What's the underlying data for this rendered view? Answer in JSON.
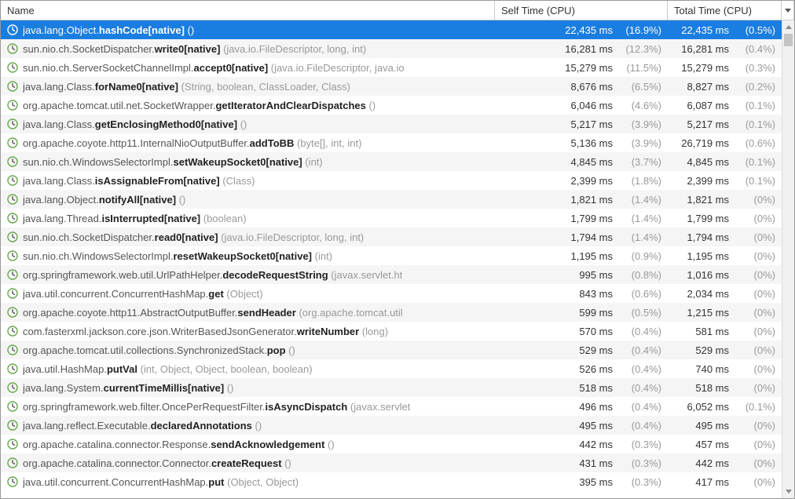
{
  "columns": {
    "name": "Name",
    "self": "Self Time (CPU)",
    "total": "Total Time (CPU)"
  },
  "rows": [
    {
      "selected": true,
      "prefix": "java.lang.Object.",
      "bold": "hashCode[native]",
      "params": " ()",
      "self_ms": "22,435 ms",
      "self_pct": "(16.9%)",
      "total_ms": "22,435 ms",
      "total_pct": "(0.5%)"
    },
    {
      "selected": false,
      "prefix": "sun.nio.ch.SocketDispatcher.",
      "bold": "write0[native]",
      "params": " (java.io.FileDescriptor, long, int)",
      "self_ms": "16,281 ms",
      "self_pct": "(12.3%)",
      "total_ms": "16,281 ms",
      "total_pct": "(0.4%)"
    },
    {
      "selected": false,
      "prefix": "sun.nio.ch.ServerSocketChannelImpl.",
      "bold": "accept0[native]",
      "params": " (java.io.FileDescriptor, java.io",
      "self_ms": "15,279 ms",
      "self_pct": "(11.5%)",
      "total_ms": "15,279 ms",
      "total_pct": "(0.3%)"
    },
    {
      "selected": false,
      "prefix": "java.lang.Class.",
      "bold": "forName0[native]",
      "params": " (String, boolean, ClassLoader, Class)",
      "self_ms": "8,676 ms",
      "self_pct": "(6.5%)",
      "total_ms": "8,827 ms",
      "total_pct": "(0.2%)"
    },
    {
      "selected": false,
      "prefix": "org.apache.tomcat.util.net.SocketWrapper.",
      "bold": "getIteratorAndClearDispatches",
      "params": " ()",
      "self_ms": "6,046 ms",
      "self_pct": "(4.6%)",
      "total_ms": "6,087 ms",
      "total_pct": "(0.1%)"
    },
    {
      "selected": false,
      "prefix": "java.lang.Class.",
      "bold": "getEnclosingMethod0[native]",
      "params": " ()",
      "self_ms": "5,217 ms",
      "self_pct": "(3.9%)",
      "total_ms": "5,217 ms",
      "total_pct": "(0.1%)"
    },
    {
      "selected": false,
      "prefix": "org.apache.coyote.http11.InternalNioOutputBuffer.",
      "bold": "addToBB",
      "params": " (byte[], int, int)",
      "self_ms": "5,136 ms",
      "self_pct": "(3.9%)",
      "total_ms": "26,719 ms",
      "total_pct": "(0.6%)"
    },
    {
      "selected": false,
      "prefix": "sun.nio.ch.WindowsSelectorImpl.",
      "bold": "setWakeupSocket0[native]",
      "params": " (int)",
      "self_ms": "4,845 ms",
      "self_pct": "(3.7%)",
      "total_ms": "4,845 ms",
      "total_pct": "(0.1%)"
    },
    {
      "selected": false,
      "prefix": "java.lang.Class.",
      "bold": "isAssignableFrom[native]",
      "params": " (Class)",
      "self_ms": "2,399 ms",
      "self_pct": "(1.8%)",
      "total_ms": "2,399 ms",
      "total_pct": "(0.1%)"
    },
    {
      "selected": false,
      "prefix": "java.lang.Object.",
      "bold": "notifyAll[native]",
      "params": " ()",
      "self_ms": "1,821 ms",
      "self_pct": "(1.4%)",
      "total_ms": "1,821 ms",
      "total_pct": "(0%)"
    },
    {
      "selected": false,
      "prefix": "java.lang.Thread.",
      "bold": "isInterrupted[native]",
      "params": " (boolean)",
      "self_ms": "1,799 ms",
      "self_pct": "(1.4%)",
      "total_ms": "1,799 ms",
      "total_pct": "(0%)"
    },
    {
      "selected": false,
      "prefix": "sun.nio.ch.SocketDispatcher.",
      "bold": "read0[native]",
      "params": " (java.io.FileDescriptor, long, int)",
      "self_ms": "1,794 ms",
      "self_pct": "(1.4%)",
      "total_ms": "1,794 ms",
      "total_pct": "(0%)"
    },
    {
      "selected": false,
      "prefix": "sun.nio.ch.WindowsSelectorImpl.",
      "bold": "resetWakeupSocket0[native]",
      "params": " (int)",
      "self_ms": "1,195 ms",
      "self_pct": "(0.9%)",
      "total_ms": "1,195 ms",
      "total_pct": "(0%)"
    },
    {
      "selected": false,
      "prefix": "org.springframework.web.util.UrlPathHelper.",
      "bold": "decodeRequestString",
      "params": " (javax.servlet.ht",
      "self_ms": "995 ms",
      "self_pct": "(0.8%)",
      "total_ms": "1,016 ms",
      "total_pct": "(0%)"
    },
    {
      "selected": false,
      "prefix": "java.util.concurrent.ConcurrentHashMap.",
      "bold": "get",
      "params": " (Object)",
      "self_ms": "843 ms",
      "self_pct": "(0.6%)",
      "total_ms": "2,034 ms",
      "total_pct": "(0%)"
    },
    {
      "selected": false,
      "prefix": "org.apache.coyote.http11.AbstractOutputBuffer.",
      "bold": "sendHeader",
      "params": " (org.apache.tomcat.util",
      "self_ms": "599 ms",
      "self_pct": "(0.5%)",
      "total_ms": "1,215 ms",
      "total_pct": "(0%)"
    },
    {
      "selected": false,
      "prefix": "com.fasterxml.jackson.core.json.WriterBasedJsonGenerator.",
      "bold": "writeNumber",
      "params": " (long)",
      "self_ms": "570 ms",
      "self_pct": "(0.4%)",
      "total_ms": "581 ms",
      "total_pct": "(0%)"
    },
    {
      "selected": false,
      "prefix": "org.apache.tomcat.util.collections.SynchronizedStack.",
      "bold": "pop",
      "params": " ()",
      "self_ms": "529 ms",
      "self_pct": "(0.4%)",
      "total_ms": "529 ms",
      "total_pct": "(0%)"
    },
    {
      "selected": false,
      "prefix": "java.util.HashMap.",
      "bold": "putVal",
      "params": " (int, Object, Object, boolean, boolean)",
      "self_ms": "526 ms",
      "self_pct": "(0.4%)",
      "total_ms": "740 ms",
      "total_pct": "(0%)"
    },
    {
      "selected": false,
      "prefix": "java.lang.System.",
      "bold": "currentTimeMillis[native]",
      "params": " ()",
      "self_ms": "518 ms",
      "self_pct": "(0.4%)",
      "total_ms": "518 ms",
      "total_pct": "(0%)"
    },
    {
      "selected": false,
      "prefix": "org.springframework.web.filter.OncePerRequestFilter.",
      "bold": "isAsyncDispatch",
      "params": " (javax.servlet",
      "self_ms": "496 ms",
      "self_pct": "(0.4%)",
      "total_ms": "6,052 ms",
      "total_pct": "(0.1%)"
    },
    {
      "selected": false,
      "prefix": "java.lang.reflect.Executable.",
      "bold": "declaredAnnotations",
      "params": " ()",
      "self_ms": "495 ms",
      "self_pct": "(0.4%)",
      "total_ms": "495 ms",
      "total_pct": "(0%)"
    },
    {
      "selected": false,
      "prefix": "org.apache.catalina.connector.Response.",
      "bold": "sendAcknowledgement",
      "params": " ()",
      "self_ms": "442 ms",
      "self_pct": "(0.3%)",
      "total_ms": "457 ms",
      "total_pct": "(0%)"
    },
    {
      "selected": false,
      "prefix": "org.apache.catalina.connector.Connector.",
      "bold": "createRequest",
      "params": " ()",
      "self_ms": "431 ms",
      "self_pct": "(0.3%)",
      "total_ms": "442 ms",
      "total_pct": "(0%)"
    },
    {
      "selected": false,
      "prefix": "java.util.concurrent.ConcurrentHashMap.",
      "bold": "put",
      "params": " (Object, Object)",
      "self_ms": "395 ms",
      "self_pct": "(0.3%)",
      "total_ms": "417 ms",
      "total_pct": "(0%)"
    }
  ]
}
